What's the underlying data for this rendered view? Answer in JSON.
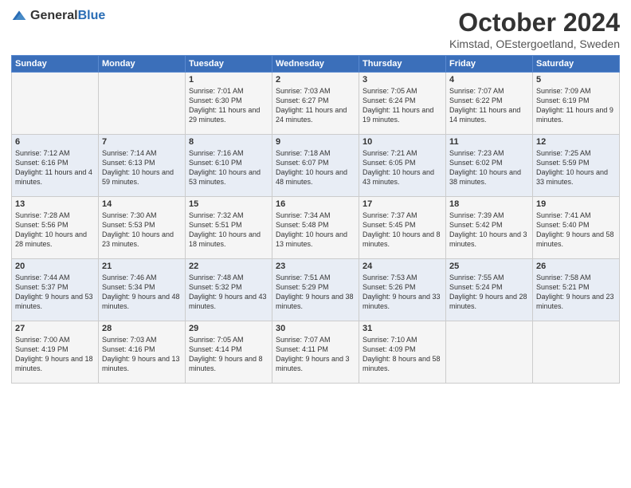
{
  "header": {
    "logo_general": "General",
    "logo_blue": "Blue",
    "month": "October 2024",
    "location": "Kimstad, OEstergoetland, Sweden"
  },
  "weekdays": [
    "Sunday",
    "Monday",
    "Tuesday",
    "Wednesday",
    "Thursday",
    "Friday",
    "Saturday"
  ],
  "weeks": [
    [
      {
        "day": "",
        "sunrise": "",
        "sunset": "",
        "daylight": ""
      },
      {
        "day": "",
        "sunrise": "",
        "sunset": "",
        "daylight": ""
      },
      {
        "day": "1",
        "sunrise": "Sunrise: 7:01 AM",
        "sunset": "Sunset: 6:30 PM",
        "daylight": "Daylight: 11 hours and 29 minutes."
      },
      {
        "day": "2",
        "sunrise": "Sunrise: 7:03 AM",
        "sunset": "Sunset: 6:27 PM",
        "daylight": "Daylight: 11 hours and 24 minutes."
      },
      {
        "day": "3",
        "sunrise": "Sunrise: 7:05 AM",
        "sunset": "Sunset: 6:24 PM",
        "daylight": "Daylight: 11 hours and 19 minutes."
      },
      {
        "day": "4",
        "sunrise": "Sunrise: 7:07 AM",
        "sunset": "Sunset: 6:22 PM",
        "daylight": "Daylight: 11 hours and 14 minutes."
      },
      {
        "day": "5",
        "sunrise": "Sunrise: 7:09 AM",
        "sunset": "Sunset: 6:19 PM",
        "daylight": "Daylight: 11 hours and 9 minutes."
      }
    ],
    [
      {
        "day": "6",
        "sunrise": "Sunrise: 7:12 AM",
        "sunset": "Sunset: 6:16 PM",
        "daylight": "Daylight: 11 hours and 4 minutes."
      },
      {
        "day": "7",
        "sunrise": "Sunrise: 7:14 AM",
        "sunset": "Sunset: 6:13 PM",
        "daylight": "Daylight: 10 hours and 59 minutes."
      },
      {
        "day": "8",
        "sunrise": "Sunrise: 7:16 AM",
        "sunset": "Sunset: 6:10 PM",
        "daylight": "Daylight: 10 hours and 53 minutes."
      },
      {
        "day": "9",
        "sunrise": "Sunrise: 7:18 AM",
        "sunset": "Sunset: 6:07 PM",
        "daylight": "Daylight: 10 hours and 48 minutes."
      },
      {
        "day": "10",
        "sunrise": "Sunrise: 7:21 AM",
        "sunset": "Sunset: 6:05 PM",
        "daylight": "Daylight: 10 hours and 43 minutes."
      },
      {
        "day": "11",
        "sunrise": "Sunrise: 7:23 AM",
        "sunset": "Sunset: 6:02 PM",
        "daylight": "Daylight: 10 hours and 38 minutes."
      },
      {
        "day": "12",
        "sunrise": "Sunrise: 7:25 AM",
        "sunset": "Sunset: 5:59 PM",
        "daylight": "Daylight: 10 hours and 33 minutes."
      }
    ],
    [
      {
        "day": "13",
        "sunrise": "Sunrise: 7:28 AM",
        "sunset": "Sunset: 5:56 PM",
        "daylight": "Daylight: 10 hours and 28 minutes."
      },
      {
        "day": "14",
        "sunrise": "Sunrise: 7:30 AM",
        "sunset": "Sunset: 5:53 PM",
        "daylight": "Daylight: 10 hours and 23 minutes."
      },
      {
        "day": "15",
        "sunrise": "Sunrise: 7:32 AM",
        "sunset": "Sunset: 5:51 PM",
        "daylight": "Daylight: 10 hours and 18 minutes."
      },
      {
        "day": "16",
        "sunrise": "Sunrise: 7:34 AM",
        "sunset": "Sunset: 5:48 PM",
        "daylight": "Daylight: 10 hours and 13 minutes."
      },
      {
        "day": "17",
        "sunrise": "Sunrise: 7:37 AM",
        "sunset": "Sunset: 5:45 PM",
        "daylight": "Daylight: 10 hours and 8 minutes."
      },
      {
        "day": "18",
        "sunrise": "Sunrise: 7:39 AM",
        "sunset": "Sunset: 5:42 PM",
        "daylight": "Daylight: 10 hours and 3 minutes."
      },
      {
        "day": "19",
        "sunrise": "Sunrise: 7:41 AM",
        "sunset": "Sunset: 5:40 PM",
        "daylight": "Daylight: 9 hours and 58 minutes."
      }
    ],
    [
      {
        "day": "20",
        "sunrise": "Sunrise: 7:44 AM",
        "sunset": "Sunset: 5:37 PM",
        "daylight": "Daylight: 9 hours and 53 minutes."
      },
      {
        "day": "21",
        "sunrise": "Sunrise: 7:46 AM",
        "sunset": "Sunset: 5:34 PM",
        "daylight": "Daylight: 9 hours and 48 minutes."
      },
      {
        "day": "22",
        "sunrise": "Sunrise: 7:48 AM",
        "sunset": "Sunset: 5:32 PM",
        "daylight": "Daylight: 9 hours and 43 minutes."
      },
      {
        "day": "23",
        "sunrise": "Sunrise: 7:51 AM",
        "sunset": "Sunset: 5:29 PM",
        "daylight": "Daylight: 9 hours and 38 minutes."
      },
      {
        "day": "24",
        "sunrise": "Sunrise: 7:53 AM",
        "sunset": "Sunset: 5:26 PM",
        "daylight": "Daylight: 9 hours and 33 minutes."
      },
      {
        "day": "25",
        "sunrise": "Sunrise: 7:55 AM",
        "sunset": "Sunset: 5:24 PM",
        "daylight": "Daylight: 9 hours and 28 minutes."
      },
      {
        "day": "26",
        "sunrise": "Sunrise: 7:58 AM",
        "sunset": "Sunset: 5:21 PM",
        "daylight": "Daylight: 9 hours and 23 minutes."
      }
    ],
    [
      {
        "day": "27",
        "sunrise": "Sunrise: 7:00 AM",
        "sunset": "Sunset: 4:19 PM",
        "daylight": "Daylight: 9 hours and 18 minutes."
      },
      {
        "day": "28",
        "sunrise": "Sunrise: 7:03 AM",
        "sunset": "Sunset: 4:16 PM",
        "daylight": "Daylight: 9 hours and 13 minutes."
      },
      {
        "day": "29",
        "sunrise": "Sunrise: 7:05 AM",
        "sunset": "Sunset: 4:14 PM",
        "daylight": "Daylight: 9 hours and 8 minutes."
      },
      {
        "day": "30",
        "sunrise": "Sunrise: 7:07 AM",
        "sunset": "Sunset: 4:11 PM",
        "daylight": "Daylight: 9 hours and 3 minutes."
      },
      {
        "day": "31",
        "sunrise": "Sunrise: 7:10 AM",
        "sunset": "Sunset: 4:09 PM",
        "daylight": "Daylight: 8 hours and 58 minutes."
      },
      {
        "day": "",
        "sunrise": "",
        "sunset": "",
        "daylight": ""
      },
      {
        "day": "",
        "sunrise": "",
        "sunset": "",
        "daylight": ""
      }
    ]
  ]
}
